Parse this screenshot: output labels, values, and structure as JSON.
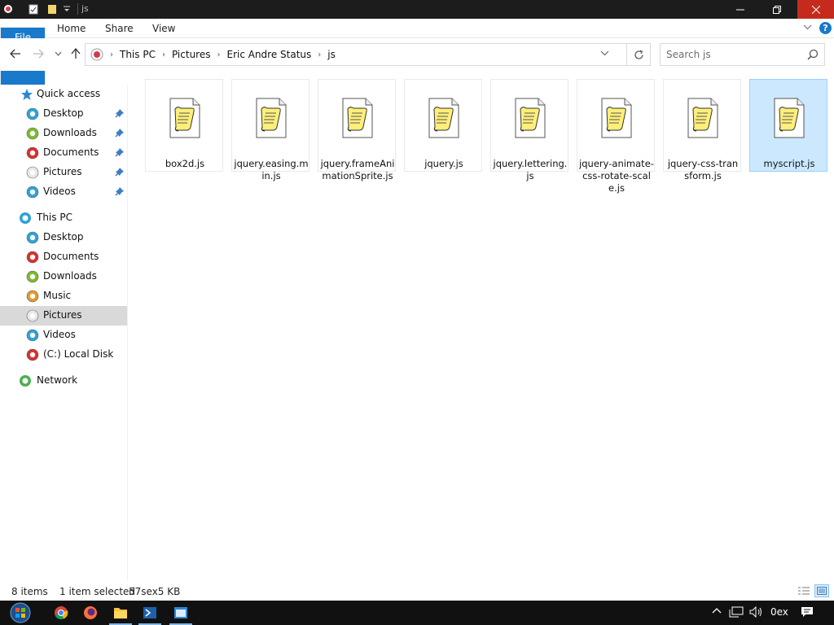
{
  "window": {
    "title": "js",
    "quick_access_icons": [
      "properties-icon",
      "new-folder-icon",
      "customize-dropdown-icon"
    ]
  },
  "ribbon": {
    "tabs": [
      {
        "label": "File"
      },
      {
        "label": "Home"
      },
      {
        "label": "Share"
      },
      {
        "label": "View"
      }
    ],
    "help_label": "?"
  },
  "address": {
    "crumbs": [
      "This PC",
      "Pictures",
      "Eric Andre Status",
      "js"
    ]
  },
  "search": {
    "placeholder": "Search js"
  },
  "nav": {
    "quick_access_label": "Quick access",
    "quick_access_items": [
      {
        "label": "Desktop",
        "icon": "desktop-icon",
        "color": "#2ba3d8"
      },
      {
        "label": "Downloads",
        "icon": "downloads-icon",
        "color": "#7cbb2c"
      },
      {
        "label": "Documents",
        "icon": "documents-icon",
        "color": "#d9302c"
      },
      {
        "label": "Pictures",
        "icon": "pictures-icon",
        "color": "#e8e8e8"
      },
      {
        "label": "Videos",
        "icon": "videos-icon",
        "color": "#2ba3d8"
      }
    ],
    "this_pc_label": "This PC",
    "this_pc_items": [
      {
        "label": "Desktop",
        "icon": "desktop-icon",
        "color": "#2ba3d8"
      },
      {
        "label": "Documents",
        "icon": "documents-icon",
        "color": "#d9302c"
      },
      {
        "label": "Downloads",
        "icon": "downloads-icon",
        "color": "#7cbb2c"
      },
      {
        "label": "Music",
        "icon": "music-icon",
        "color": "#e09a2a"
      },
      {
        "label": "Pictures",
        "icon": "pictures-icon",
        "color": "#e8e8e8",
        "selected": true
      },
      {
        "label": "Videos",
        "icon": "videos-icon",
        "color": "#2ba3d8"
      },
      {
        "label": "(C:) Local Disk",
        "icon": "local-disk-icon",
        "color": "#d9302c"
      }
    ],
    "network_label": "Network"
  },
  "files": [
    {
      "name": "box2d.js"
    },
    {
      "name": "jquery.easing.min.js"
    },
    {
      "name": "jquery.frameAnimationSprite.js"
    },
    {
      "name": "jquery.js"
    },
    {
      "name": "jquery.lettering.js"
    },
    {
      "name": "jquery-animate-css-rotate-scale.js"
    },
    {
      "name": "jquery-css-transform.js"
    },
    {
      "name": "myscript.js",
      "selected": true
    }
  ],
  "status": {
    "item_count": "8 items",
    "selection": "1 item selected",
    "size": "57sex5 KB"
  },
  "taskbar": {
    "apps": [
      "start-icon",
      "chrome-icon",
      "firefox-icon",
      "file-explorer-icon",
      "powershell-icon",
      "window-app-icon"
    ],
    "clock": "0ex"
  }
}
